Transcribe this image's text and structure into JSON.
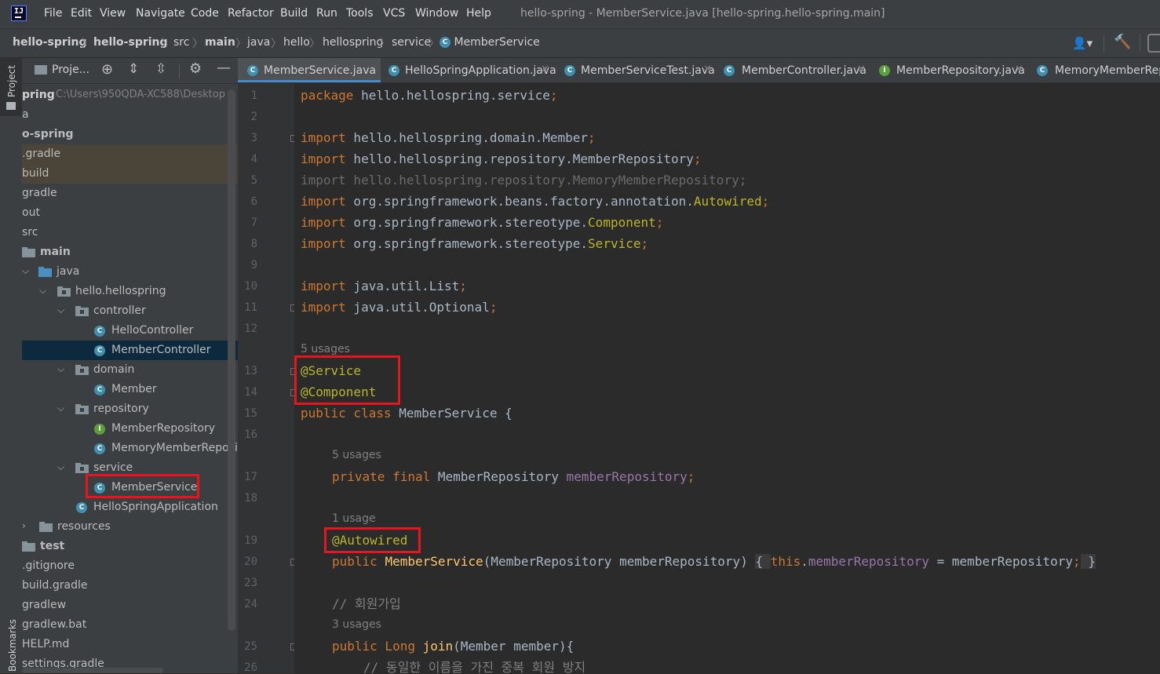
{
  "window": {
    "title": "hello-spring - MemberService.java [hello-spring.hello-spring.main]"
  },
  "menu": [
    "File",
    "Edit",
    "View",
    "Navigate",
    "Code",
    "Refactor",
    "Build",
    "Run",
    "Tools",
    "VCS",
    "Window",
    "Help"
  ],
  "breadcrumb": [
    "hello-spring",
    "hello-spring",
    "src",
    "main",
    "java",
    "hello",
    "hellospring",
    "service",
    "MemberService"
  ],
  "left_strip": {
    "project": "Project",
    "bookmarks": "Bookmarks"
  },
  "project_panel": {
    "title": "Proje...",
    "tree": [
      {
        "label": "pring",
        "path": "C:\\Users\\950QDA-XC588\\Desktop"
      },
      {
        "label": "a"
      },
      {
        "label": "o-spring"
      },
      {
        "label": ".gradle"
      },
      {
        "label": "build"
      },
      {
        "label": "gradle"
      },
      {
        "label": "out"
      },
      {
        "label": "src"
      },
      {
        "label": "main"
      },
      {
        "label": "java"
      },
      {
        "label": "hello.hellospring"
      },
      {
        "label": "controller"
      },
      {
        "label": "HelloController"
      },
      {
        "label": "MemberController"
      },
      {
        "label": "domain"
      },
      {
        "label": "Member"
      },
      {
        "label": "repository"
      },
      {
        "label": "MemberRepository"
      },
      {
        "label": "MemoryMemberRepository"
      },
      {
        "label": "service"
      },
      {
        "label": "MemberService"
      },
      {
        "label": "HelloSpringApplication"
      },
      {
        "label": "resources"
      },
      {
        "label": "test"
      },
      {
        "label": ".gitignore"
      },
      {
        "label": "build.gradle"
      },
      {
        "label": "gradlew"
      },
      {
        "label": "gradlew.bat"
      },
      {
        "label": "HELP.md"
      },
      {
        "label": "settings.gradle"
      }
    ]
  },
  "tabs": [
    {
      "label": "MemberService.java",
      "active": true
    },
    {
      "label": "HelloSpringApplication.java"
    },
    {
      "label": "MemberServiceTest.java"
    },
    {
      "label": "MemberController.java"
    },
    {
      "label": "MemberRepository.java"
    },
    {
      "label": "MemoryMemberRepo"
    }
  ],
  "gutter_lines": [
    "1",
    "2",
    "3",
    "4",
    "5",
    "6",
    "7",
    "8",
    "9",
    "10",
    "11",
    "12",
    "13",
    "14",
    "15",
    "16",
    "17",
    "18",
    "19",
    "20",
    "23",
    "24",
    "25",
    "26"
  ],
  "code": {
    "l1_kw": "package",
    "l1_rest": " hello.hellospring.service",
    "import_kw": "import",
    "l3": " hello.hellospring.domain.Member",
    "l4": " hello.hellospring.repository.MemberRepository",
    "l5": "import hello.hellospring.repository.MemoryMemberRepository;",
    "l6_a": " org.springframework.beans.factory.annotation.",
    "l6_b": "Autowired",
    "l7_a": " org.springframework.stereotype.",
    "l7_b": "Component",
    "l8_a": " org.springframework.stereotype.",
    "l8_b": "Service",
    "l10": " java.util.List",
    "l11": " java.util.Optional",
    "usage_class": "5 usages",
    "l13": "@Service",
    "l14": "@Component",
    "l15_kw": "public class",
    "l15_rest": " MemberService {",
    "usage_field": "5 usages",
    "l17_kw": "private final",
    "l17_type": " MemberRepository ",
    "l17_field": "memberRepository",
    "usage_ctor": "1 usage",
    "l19": "@Autowired",
    "l20_kw": "public",
    "l20_fn": "MemberService",
    "l20_params": "(MemberRepository memberRepository) ",
    "l20_open": "{ ",
    "l20_this": "this",
    "l20_field": "memberRepository",
    "l20_assign": " = memberRepository",
    "l20_close": " }",
    "l24": "// 회원가입",
    "usage_join": "3 usages",
    "l25_kw": "public",
    "l25_type": " Long ",
    "l25_fn": "join",
    "l25_rest": "(Member member){",
    "l26": "// 동일한 이름을 가진 중복 회원 방지"
  },
  "colors": {
    "highlight_box": "#e8141e",
    "keyword": "#cc7832",
    "annotation": "#bbb529",
    "field": "#9876aa",
    "function": "#ffc66d"
  }
}
